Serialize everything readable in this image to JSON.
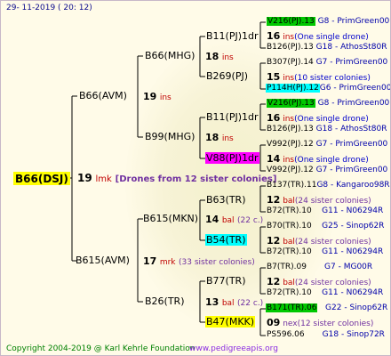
{
  "date": "29- 11-2019 ( 20: 12)",
  "root": {
    "name": "B66(DSJ)",
    "num": "19",
    "breed": "lmk",
    "note": "[Drones from 12 sister colonies]"
  },
  "sire": {
    "name": "B66(AVM)",
    "num": "19",
    "breed": "ins"
  },
  "dam": {
    "name": "B615(AVM)",
    "num": "17",
    "breed": "mrk",
    "note": "(33 sister colonies)"
  },
  "ss": {
    "name": "B66(MHG)",
    "num": "18",
    "breed": "ins"
  },
  "sd": {
    "name": "B99(MHG)",
    "num": "18",
    "breed": "ins"
  },
  "ds": {
    "name": "B615(MKN)",
    "num": "14",
    "breed": "bal",
    "note": "(22 c.)"
  },
  "dd": {
    "name": "B26(TR)",
    "num": "13",
    "breed": "bal",
    "note": "(22 c.)"
  },
  "sss": {
    "name": "B11(PJ)1dr"
  },
  "ssd": {
    "name": "B269(PJ)"
  },
  "sds": {
    "name": "B11(PJ)1dr"
  },
  "sdd": {
    "name": "V88(PJ)1dr"
  },
  "dss": {
    "name": "B63(TR)"
  },
  "dsd": {
    "name": "B54(TR)"
  },
  "dds": {
    "name": "B77(TR)"
  },
  "ddd": {
    "name": "B47(MKK)"
  },
  "right": [
    {
      "name": "V216(PJ).13",
      "code": "G8 -",
      "owner": "PrimGreen00"
    },
    {
      "num": "16",
      "breed": "ins",
      "note": "(One single drone)"
    },
    {
      "name": "B126(PJ).13",
      "code": "G18 -",
      "owner": "AthosSt80R"
    },
    {
      "name": "B307(PJ).14",
      "code": "G7 -",
      "owner": "PrimGreen00"
    },
    {
      "num": "15",
      "breed": "ins",
      "note": "(10 sister colonies)"
    },
    {
      "name": "P114H(PJ).12",
      "code": "G6 -",
      "owner": "PrimGreen00"
    },
    {
      "name": "V216(PJ).13",
      "code": "G8 -",
      "owner": "PrimGreen00"
    },
    {
      "num": "16",
      "breed": "ins",
      "note": "(One single drone)"
    },
    {
      "name": "B126(PJ).13",
      "code": "G18 -",
      "owner": "AthosSt80R"
    },
    {
      "name": "V992(PJ).12",
      "code": "G7 -",
      "owner": "PrimGreen00"
    },
    {
      "num": "14",
      "breed": "ins",
      "note": "(One single drone)"
    },
    {
      "name": "V992(PJ).12",
      "code": "G7 -",
      "owner": "PrimGreen00"
    },
    {
      "name": "B137(TR).11",
      "code": "G8 -",
      "owner": "Kangaroo98R"
    },
    {
      "num": "12",
      "breed": "bal",
      "note": "(24 sister colonies)"
    },
    {
      "name": "B72(TR).10",
      "code": "G11 -",
      "owner": "N06294R"
    },
    {
      "name": "B70(TR).10",
      "code": "G25 -",
      "owner": "Sinop62R"
    },
    {
      "num": "12",
      "breed": "bal",
      "note": "(24 sister colonies)"
    },
    {
      "name": "B72(TR).10",
      "code": "G11 -",
      "owner": "N06294R"
    },
    {
      "name": "B7(TR).09",
      "code": "G7 -",
      "owner": "MG00R"
    },
    {
      "num": "12",
      "breed": "bal",
      "note": "(24 sister colonies)"
    },
    {
      "name": "B72(TR).10",
      "code": "G11 -",
      "owner": "N06294R"
    },
    {
      "name": "B171(TR).06",
      "code": "G22 -",
      "owner": "Sinop62R"
    },
    {
      "num": "09",
      "breed": "nex",
      "note": "(12 sister colonies)"
    },
    {
      "name": "PS596.06",
      "code": "G18 -",
      "owner": "Sinop72R"
    }
  ],
  "footer": {
    "copyright": "Copyright 2004-2019 @ Karl Kehrle Foundation",
    "site": "www.pedigreeapis.org"
  }
}
